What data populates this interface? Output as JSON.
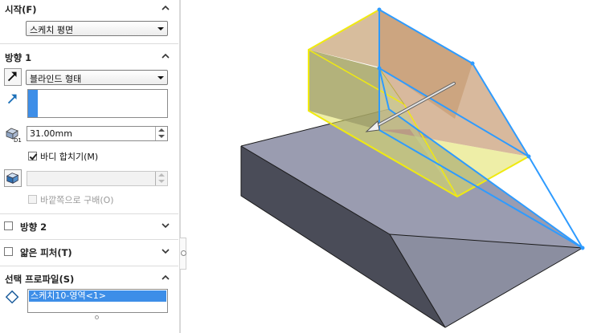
{
  "panel": {
    "start": {
      "title": "시작(F)",
      "plane_value": "스케치 평면"
    },
    "direction1": {
      "title": "방향 1",
      "end_condition": "블라인드 형태",
      "depth": "31.00mm",
      "merge_label": "바디 합치기(M)",
      "merge_checked": true,
      "draft_outward_label": "바깥쪽으로 구배(O)"
    },
    "direction2": {
      "title": "방향 2"
    },
    "thin_feature": {
      "title": "얇은 피처(T)"
    },
    "selected_contours": {
      "title": "선택 프로파일(S)",
      "items": [
        "스케치10-영역<1>"
      ]
    }
  },
  "icons": {
    "collapse": "chevron-up-icon",
    "expand": "chevron-down-icon",
    "reverse_direction": "reverse-direction-icon",
    "direction_vector": "direction-arrow-icon",
    "depth": "depth-dimension-icon",
    "draft": "draft-icon",
    "contour": "contour-diamond-icon"
  },
  "colors": {
    "accent_blue": "#3d8ee8",
    "preview_yellow": "#e8e800",
    "edge_blue": "#2e9bff",
    "solid_gray": "#9598aa"
  }
}
